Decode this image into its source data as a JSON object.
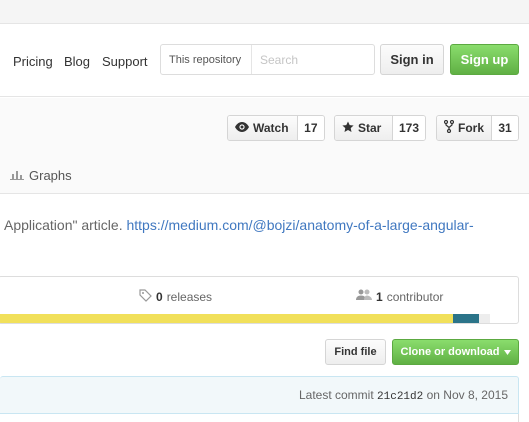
{
  "nav": {
    "pricing": "Pricing",
    "blog": "Blog",
    "support": "Support"
  },
  "search": {
    "scope": "This repository",
    "placeholder": "Search",
    "value": ""
  },
  "auth": {
    "sign_in": "Sign in",
    "sign_up": "Sign up"
  },
  "social": {
    "watch": {
      "label": "Watch",
      "count": "17"
    },
    "star": {
      "label": "Star",
      "count": "173"
    },
    "fork": {
      "label": "Fork",
      "count": "31"
    }
  },
  "tabs": {
    "graphs": "Graphs"
  },
  "description": {
    "text": "Application\" article. ",
    "link": "https://medium.com/@bojzi/anatomy-of-a-large-angular-"
  },
  "stats": {
    "releases": {
      "count": "0",
      "label": "releases"
    },
    "contributors": {
      "count": "1",
      "label": "contributor"
    }
  },
  "languages": [
    {
      "share": 0.875,
      "color": "#f1e05a"
    },
    {
      "share": 0.049,
      "color": "#2b7489"
    },
    {
      "share": 0.023,
      "color": "#ededed"
    }
  ],
  "file_actions": {
    "find_file": "Find file",
    "clone": "Clone or download"
  },
  "commit": {
    "prefix": "Latest commit",
    "sha": "21c21d2",
    "date": "on Nov 8, 2015"
  },
  "colors": {
    "accent_green": "#60b044",
    "link": "#4078c0"
  }
}
